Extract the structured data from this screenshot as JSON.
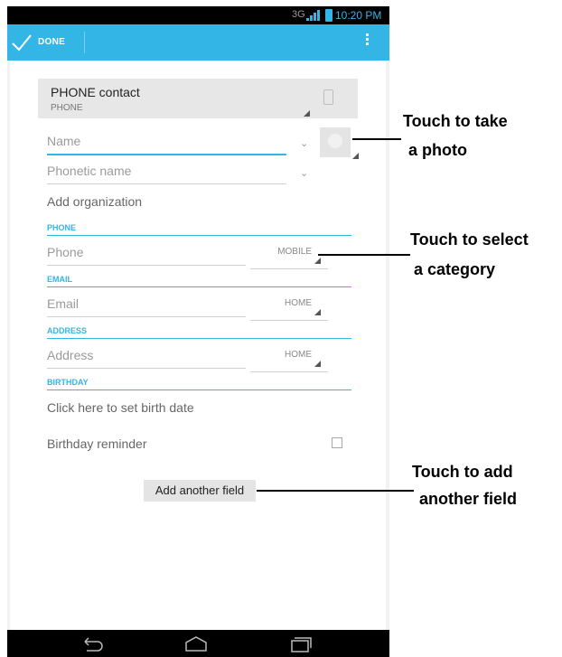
{
  "status_bar": {
    "network": "3G",
    "time": "10:20 PM"
  },
  "action_bar": {
    "done_label": "DONE"
  },
  "account": {
    "name": "PHONE contact",
    "type": "PHONE"
  },
  "fields": {
    "name_placeholder": "Name",
    "phonetic_placeholder": "Phonetic name",
    "add_organization": "Add organization"
  },
  "sections": {
    "phone": {
      "header": "PHONE",
      "placeholder": "Phone",
      "type": "MOBILE"
    },
    "email": {
      "header": "EMAIL",
      "placeholder": "Email",
      "type": "HOME"
    },
    "address": {
      "header": "ADDRESS",
      "placeholder": "Address",
      "type": "HOME"
    },
    "birthday": {
      "header": "BIRTHDAY",
      "set_date": "Click here to set birth date",
      "reminder": "Birthday reminder"
    }
  },
  "add_field_button": "Add another field",
  "callouts": {
    "photo": [
      "Touch to take",
      "a photo"
    ],
    "category": [
      "Touch to select",
      "a category"
    ],
    "add_field": [
      "Touch to add",
      "another field"
    ]
  },
  "colors": {
    "accent": "#33b5e5",
    "status_bar": "#000000",
    "background": "#f2f2f2"
  },
  "icons": [
    "checkmark-icon",
    "overflow-menu-icon",
    "phone-icon",
    "contact-photo-icon",
    "back-icon",
    "home-icon",
    "recent-apps-icon",
    "signal-icon",
    "battery-icon"
  ]
}
